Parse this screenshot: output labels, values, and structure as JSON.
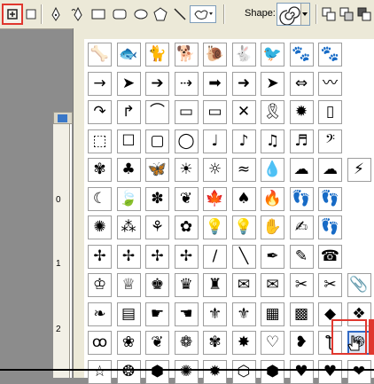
{
  "optionsBar": {
    "shapeLabel": "Shape:",
    "selectedShapeIcon": "spiral-icon"
  },
  "ruler": {
    "marks": [
      "0",
      "1",
      "2"
    ]
  },
  "palette": {
    "selectedShape": "spiral",
    "shapes": [
      [
        "bone",
        "fish",
        "cat",
        "dog",
        "snail",
        "rabbit",
        "bird",
        "paw-print",
        "paw-print-2"
      ],
      [
        "arrow-thin",
        "arrow-bold",
        "arrow-line",
        "arrow-decorative",
        "arrow-block",
        "arrow-notched",
        "arrow-pointer",
        "arrow-double",
        "wave-line"
      ],
      [
        "arrow-curved",
        "arrow-turn",
        "banner-curved",
        "banner",
        "banner-tilted",
        "ribbon",
        "awareness-ribbon",
        "seal",
        "scroll"
      ],
      [
        "frame-stamp",
        "frame-square",
        "frame-ornate",
        "frame-circle",
        "note-eighth",
        "note-quarter",
        "note-pair",
        "note-beamed",
        "clef-bass"
      ],
      [
        "fern",
        "clover",
        "butterfly",
        "sun-burst",
        "sun",
        "waves",
        "raindrop",
        "cloud-blob",
        "cloud",
        "lightning"
      ],
      [
        "moon",
        "leaf",
        "maple-leaf-thin",
        "leaf-small",
        "maple-leaf",
        "tree",
        "fire",
        "footprint",
        "footprints"
      ],
      [
        "flower",
        "grass",
        "grass-blade",
        "grass-tuft",
        "lightbulb",
        "lightbulb-on",
        "hand",
        "right-hand",
        "footprint-left"
      ],
      [
        "puzzle-piece",
        "puzzle-piece-2",
        "puzzle-piece-3",
        "puzzle-piece-4",
        "pencil",
        "brush",
        "pen-nib",
        "pencil-2",
        "telephone"
      ],
      [
        "crown-small",
        "crown",
        "king-crown",
        "crown-ornate",
        "castle",
        "envelope",
        "envelope-open",
        "scissors",
        "scissors-2",
        "paperclip"
      ],
      [
        "leaf-sprig",
        "flag",
        "pointing-hand",
        "pointing-hand-2",
        "fleur-de-lis",
        "fleur-de-lis-2",
        "tile-pattern",
        "tile-ornate",
        "diamond-ornament",
        "ornament"
      ],
      [
        "ornament-swirl",
        "floral-ornament",
        "vine",
        "flower-daisy",
        "ornament-flourish",
        "flower-bloom",
        "heart-leaf",
        "floral-heart",
        "spiral-ornament",
        "spiral"
      ],
      [
        "star",
        "circle-stamp",
        "circle-badge",
        "sun-ornate",
        "circle-gear",
        "hexagon",
        "shield",
        "heart",
        "heart-solid",
        "diamond"
      ]
    ]
  },
  "glyphs": [
    [
      "🦴",
      "🐟",
      "🐈",
      "🐕",
      "🐌",
      "🐇",
      "🐦",
      "🐾",
      "🐾"
    ],
    [
      "→",
      "➤",
      "➔",
      "⇢",
      "➡",
      "➜",
      "➤",
      "⇔",
      "〰"
    ],
    [
      "↷",
      "↱",
      "⌒",
      "▭",
      "▭",
      "✕",
      "🎗",
      "✹",
      "▯"
    ],
    [
      "⬚",
      "☐",
      "▢",
      "◯",
      "♩",
      "♪",
      "♫",
      "♬",
      "𝄢"
    ],
    [
      "✾",
      "♣",
      "🦋",
      "☀",
      "☼",
      "≈",
      "💧",
      "☁",
      "☁",
      "⚡"
    ],
    [
      "☾",
      "🍃",
      "✽",
      "❦",
      "🍁",
      "♠",
      "🔥",
      "👣",
      "👣"
    ],
    [
      "✺",
      "⁂",
      "⚘",
      "✿",
      "💡",
      "💡",
      "✋",
      "✍",
      "👣"
    ],
    [
      "✢",
      "✢",
      "✢",
      "✢",
      "/",
      "╲",
      "✒",
      "✎",
      "☎"
    ],
    [
      "♔",
      "♕",
      "♚",
      "♛",
      "♜",
      "✉",
      "✉",
      "✂",
      "✂",
      "📎"
    ],
    [
      "❧",
      "▤",
      "☛",
      "☚",
      "⚜",
      "⚜",
      "▦",
      "▩",
      "◆",
      "❖"
    ],
    [
      "ꝏ",
      "❀",
      "❦",
      "❁",
      "✾",
      "✸",
      "♡",
      "❥",
      "ƪ",
      "֍"
    ],
    [
      "☆",
      "❂",
      "⬢",
      "✺",
      "✹",
      "⬡",
      "⬢",
      "♥",
      "♥",
      "❤"
    ]
  ]
}
